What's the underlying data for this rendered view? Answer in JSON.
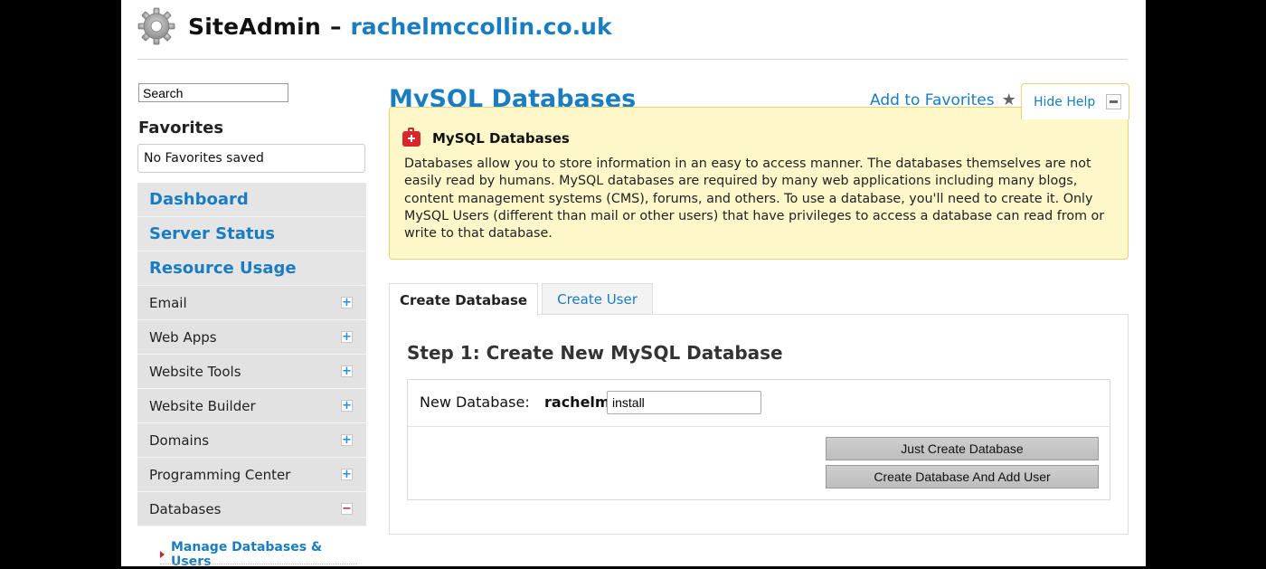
{
  "header": {
    "app_name": "SiteAdmin",
    "separator": "–",
    "domain": "rachelmccollin.co.uk"
  },
  "sidebar": {
    "search_value": "Search",
    "favorites_title": "Favorites",
    "favorites_empty": "No Favorites saved",
    "primary_items": [
      {
        "label": "Dashboard"
      },
      {
        "label": "Server Status"
      },
      {
        "label": "Resource Usage"
      }
    ],
    "items": [
      {
        "label": "Email",
        "toggle": "+"
      },
      {
        "label": "Web Apps",
        "toggle": "+"
      },
      {
        "label": "Website Tools",
        "toggle": "+"
      },
      {
        "label": "Website Builder",
        "toggle": "+"
      },
      {
        "label": "Domains",
        "toggle": "+"
      },
      {
        "label": "Programming Center",
        "toggle": "+"
      },
      {
        "label": "Databases",
        "toggle": "−"
      }
    ],
    "sub_items": [
      {
        "label": "Manage Databases & Users"
      }
    ]
  },
  "main": {
    "title": "MySQL Databases",
    "add_favorites": "Add to Favorites",
    "hide_help": "Hide Help",
    "help": {
      "title": "MySQL Databases",
      "text": "Databases allow you to store information in an easy to access manner. The databases themselves are not easily read by humans. MySQL databases are required by many web applications including many blogs, content management systems (CMS), forums, and others. To use a database, you'll need to create it. Only MySQL Users (different than mail or other users) that have privileges to access a database can read from or write to that database."
    },
    "tabs": [
      {
        "label": "Create Database"
      },
      {
        "label": "Create User"
      }
    ],
    "step_title": "Step 1: Create New MySQL Database",
    "form": {
      "label": "New Database:",
      "prefix": "rachelm_",
      "value": "install"
    },
    "buttons": {
      "just_create": "Just Create Database",
      "create_add_user": "Create Database And Add User"
    }
  },
  "colors": {
    "accent": "#1a7dc0",
    "help_bg": "#fdf7c9",
    "help_border": "#e7d37b",
    "minus": "#c9243a"
  },
  "icons": {
    "logo": "gear-icon",
    "favorite": "star-icon",
    "help": "first-aid-kit-icon",
    "collapse": "minus-box-icon"
  }
}
